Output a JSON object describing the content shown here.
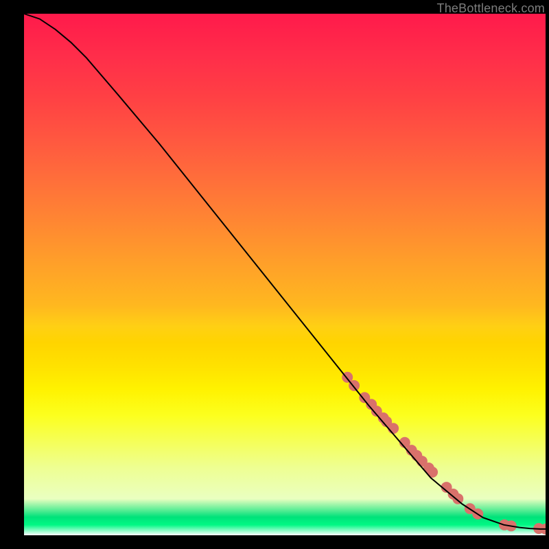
{
  "attribution": "TheBottleneck.com",
  "chart_data": {
    "type": "line",
    "title": "",
    "xlabel": "",
    "ylabel": "",
    "xlim": [
      0,
      100
    ],
    "ylim": [
      0,
      100
    ],
    "grid": false,
    "curve": {
      "name": "bottleneck-curve",
      "x": [
        0,
        3,
        6,
        9,
        12,
        18,
        26,
        34,
        42,
        50,
        58,
        66,
        72,
        78,
        84,
        88,
        92,
        95,
        97,
        99,
        100
      ],
      "y": [
        100,
        99,
        97,
        94.5,
        91.5,
        84.5,
        75,
        65,
        55,
        45,
        35,
        25,
        18,
        11,
        6,
        3.4,
        2,
        1.5,
        1.3,
        1.2,
        1.2
      ]
    },
    "markers": {
      "name": "highlighted-range",
      "color": "#d9716b",
      "radius_pct": 1.05,
      "x": [
        62,
        63.3,
        65.3,
        66.6,
        67.6,
        68.9,
        69.5,
        70.8,
        73.0,
        74.3,
        75.3,
        76.3,
        77.6,
        78.3,
        81.0,
        82.3,
        83.2,
        85.5,
        87.0,
        92.1,
        93.4,
        98.7,
        100.0
      ],
      "y": [
        30.3,
        28.7,
        26.4,
        25.1,
        23.8,
        22.5,
        21.8,
        20.5,
        17.8,
        16.3,
        15.3,
        14.2,
        12.9,
        12.1,
        9.2,
        7.9,
        7.0,
        5.1,
        4.1,
        2.0,
        1.8,
        1.3,
        1.2
      ]
    }
  }
}
